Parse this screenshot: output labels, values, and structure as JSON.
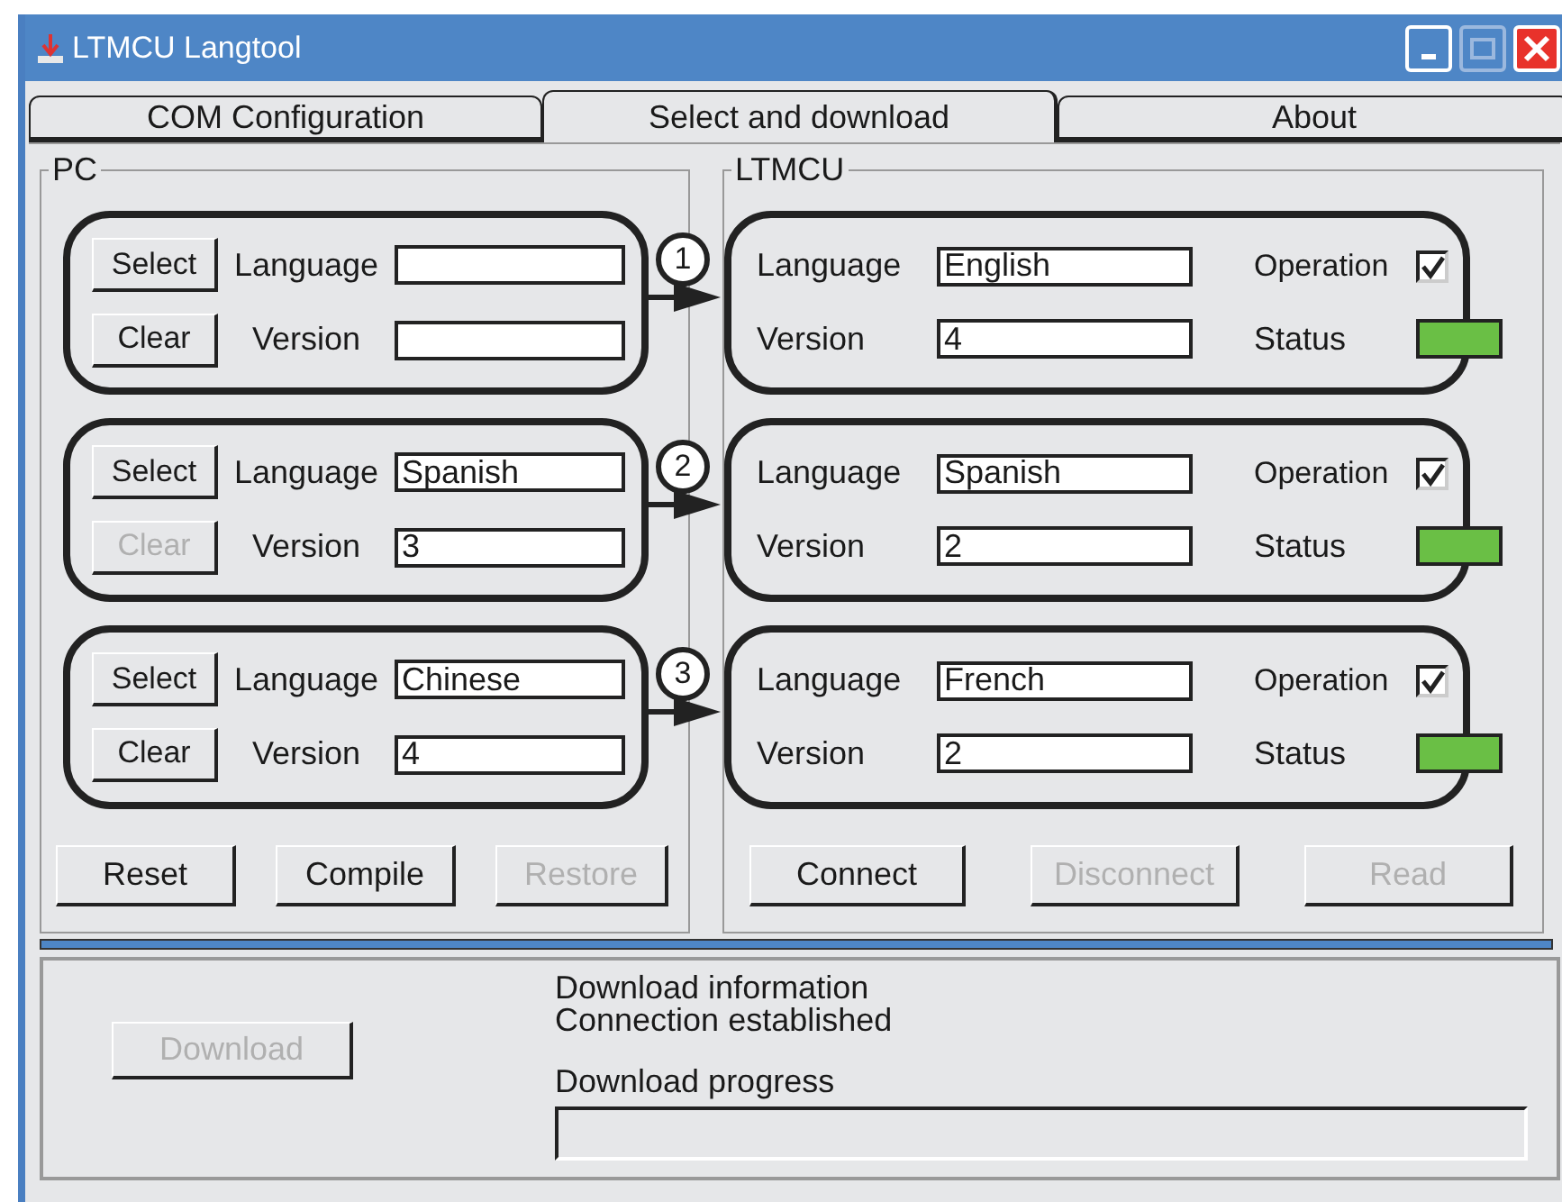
{
  "window": {
    "title": "LTMCU Langtool"
  },
  "tabs": [
    {
      "label": "COM Configuration",
      "selected": false
    },
    {
      "label": "Select and download",
      "selected": true
    },
    {
      "label": "About",
      "selected": false
    }
  ],
  "pc": {
    "title": "PC",
    "rows": [
      {
        "select": {
          "label": "Select",
          "disabled": false
        },
        "clear": {
          "label": "Clear",
          "disabled": false
        },
        "language_label": "Language",
        "language": "",
        "version_label": "Version",
        "version": ""
      },
      {
        "select": {
          "label": "Select",
          "disabled": false
        },
        "clear": {
          "label": "Clear",
          "disabled": true
        },
        "language_label": "Language",
        "language": "Spanish",
        "version_label": "Version",
        "version": "3"
      },
      {
        "select": {
          "label": "Select",
          "disabled": false
        },
        "clear": {
          "label": "Clear",
          "disabled": false
        },
        "language_label": "Language",
        "language": "Chinese",
        "version_label": "Version",
        "version": "4"
      }
    ],
    "buttons": [
      {
        "label": "Reset",
        "disabled": false
      },
      {
        "label": "Compile",
        "disabled": false
      },
      {
        "label": "Restore",
        "disabled": true
      }
    ]
  },
  "connectors": [
    "1",
    "2",
    "3"
  ],
  "ltmcu": {
    "title": "LTMCU",
    "rows": [
      {
        "language_label": "Language",
        "language": "English",
        "version_label": "Version",
        "version": "4",
        "operation_label": "Operation",
        "operation": true,
        "status_label": "Status",
        "color": "#6abf45"
      },
      {
        "language_label": "Language",
        "language": "Spanish",
        "version_label": "Version",
        "version": "2",
        "operation_label": "Operation",
        "operation": true,
        "status_label": "Status",
        "color": "#6abf45"
      },
      {
        "language_label": "Language",
        "language": "French",
        "version_label": "Version",
        "version": "2",
        "operation_label": "Operation",
        "operation": true,
        "status_label": "Status",
        "color": "#6abf45"
      }
    ],
    "buttons": [
      {
        "label": "Connect",
        "disabled": false
      },
      {
        "label": "Disconnect",
        "disabled": true
      },
      {
        "label": "Read",
        "disabled": true
      }
    ]
  },
  "download": {
    "button": {
      "label": "Download",
      "disabled": true
    },
    "info_title": "Download information",
    "info": "Connection established",
    "progress_label": "Download progress",
    "level": 0
  }
}
